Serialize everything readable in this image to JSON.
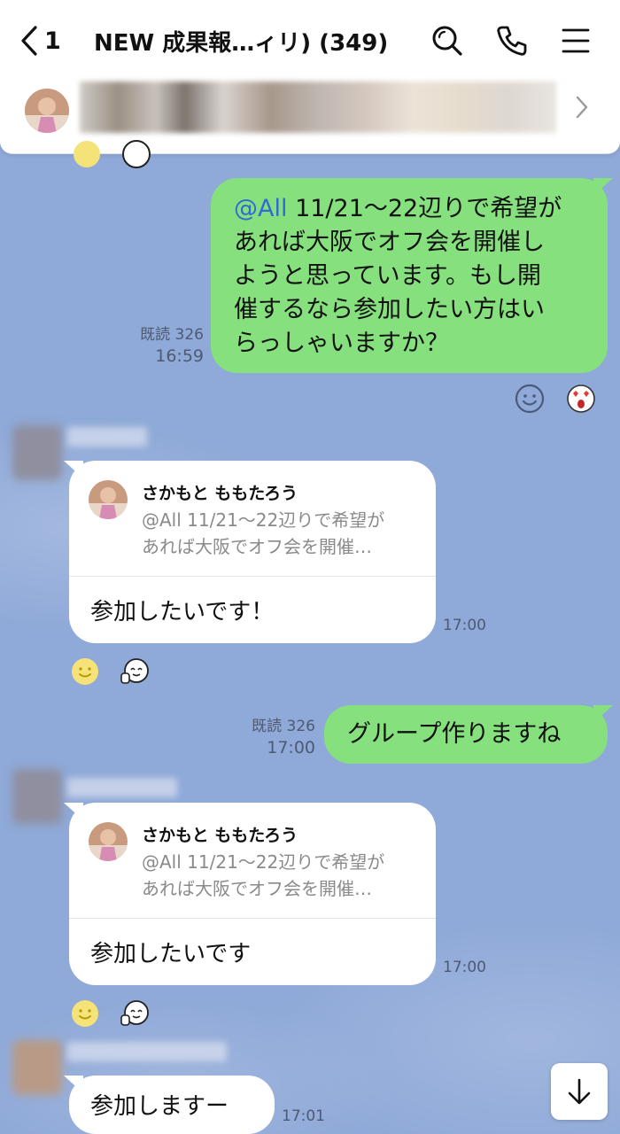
{
  "header": {
    "back_count": "1",
    "title": "NEW 成果報…ィリ) (349)",
    "icons": [
      "search-icon",
      "phone-icon",
      "menu-icon"
    ]
  },
  "announcement": {
    "icon": "chevron-right-icon"
  },
  "messages": [
    {
      "type": "outgoing",
      "mention": "@All",
      "text_lines": [
        " 11/21～22辺りで希望が",
        "あれば大阪でオフ会を開催し",
        "ようと思っています。もし開",
        "催するなら参加したい方はい",
        "らっしゃいますか？"
      ],
      "read": "既読 326",
      "time": "16:59"
    },
    {
      "type": "incoming_reply",
      "reply_to_name": "さかもと ももたろう",
      "reply_to_text_lines": [
        "@All 11/21～22辺りで希望が",
        "あれば大阪でオフ会を開催…"
      ],
      "text": "参加したいです！",
      "time": "17:00"
    },
    {
      "type": "outgoing",
      "text": "グループ作りますね",
      "read": "既読 326",
      "time": "17:00"
    },
    {
      "type": "incoming_reply",
      "reply_to_name": "さかもと ももたろう",
      "reply_to_text_lines": [
        "@All 11/21～22辺りで希望が",
        "あれば大阪でオフ会を開催…"
      ],
      "text": "参加したいです",
      "time": "17:00"
    },
    {
      "type": "incoming",
      "text": "参加しますー",
      "time": "17:01"
    }
  ],
  "colors": {
    "background": "#8fa9d8",
    "outgoing_bubble": "#85e07d",
    "mention": "#2f6ad6"
  }
}
